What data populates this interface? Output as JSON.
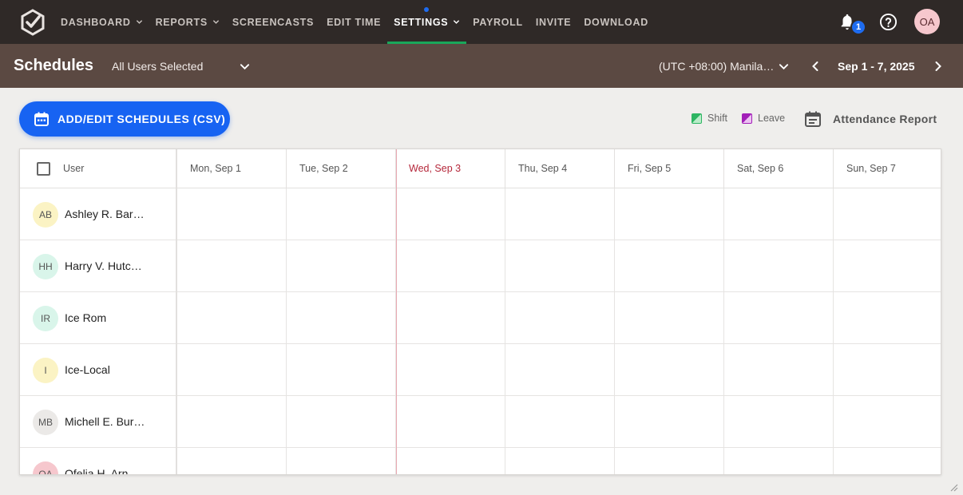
{
  "nav": {
    "items": [
      {
        "label": "DASHBOARD",
        "dropdown": true,
        "active": false
      },
      {
        "label": "REPORTS",
        "dropdown": true,
        "active": false
      },
      {
        "label": "SCREENCASTS",
        "dropdown": false,
        "active": false
      },
      {
        "label": "EDIT TIME",
        "dropdown": false,
        "active": false
      },
      {
        "label": "SETTINGS",
        "dropdown": true,
        "active": true
      },
      {
        "label": "PAYROLL",
        "dropdown": false,
        "active": false
      },
      {
        "label": "INVITE",
        "dropdown": false,
        "active": false
      },
      {
        "label": "DOWNLOAD",
        "dropdown": false,
        "active": false
      }
    ],
    "notification_count": "1",
    "user_initials": "OA"
  },
  "header": {
    "title": "Schedules",
    "user_filter": "All Users Selected",
    "timezone": "(UTC +08:00) Manila…",
    "date_range": "Sep 1 - 7, 2025"
  },
  "actions": {
    "add_button": "ADD/EDIT SCHEDULES (CSV)",
    "legend_shift": "Shift",
    "legend_leave": "Leave",
    "attendance_report": "Attendance Report"
  },
  "colors": {
    "shift": "#2db562",
    "leave": "#a21fb8",
    "accent": "#1763f2",
    "today": "#b5283b"
  },
  "table": {
    "user_header": "User",
    "days": [
      "Mon, Sep 1",
      "Tue, Sep 2",
      "Wed, Sep 3",
      "Thu, Sep 4",
      "Fri, Sep 5",
      "Sat, Sep 6",
      "Sun, Sep 7"
    ],
    "today_index": 2,
    "users": [
      {
        "initials": "AB",
        "name": "Ashley R. Bar…",
        "color": "#fbf3c4"
      },
      {
        "initials": "HH",
        "name": "Harry V. Hutc…",
        "color": "#d9f5ea"
      },
      {
        "initials": "IR",
        "name": "Ice Rom",
        "color": "#d9f5ea"
      },
      {
        "initials": "I",
        "name": "Ice-Local",
        "color": "#fbf3c4"
      },
      {
        "initials": "MB",
        "name": "Michell E. Bur…",
        "color": "#ebe9e7"
      },
      {
        "initials": "OA",
        "name": "Ofelia H. Arn…",
        "color": "#f6c7cd"
      }
    ]
  }
}
